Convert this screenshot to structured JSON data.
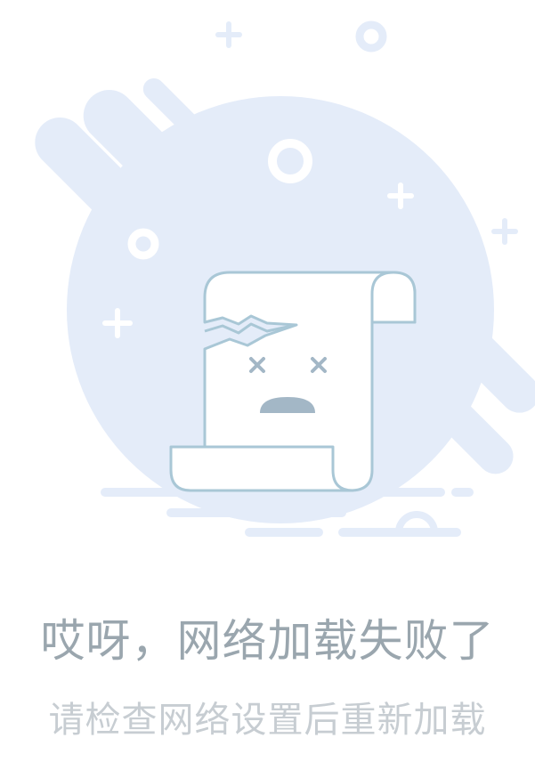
{
  "error": {
    "title": "哎呀，网络加载失败了",
    "subtitle": "请检查网络设置后重新加载"
  },
  "colors": {
    "blob": "#e4ecf9",
    "paper_stroke": "#a9c7d6",
    "face": "#a3b7c6",
    "title_text": "#9aa6ae",
    "subtitle_text": "#c7cdd2"
  },
  "icons": [
    "plus-icon",
    "ring-icon",
    "broken-scroll-icon",
    "dizzy-eyes-icon",
    "sad-mouth-icon"
  ]
}
